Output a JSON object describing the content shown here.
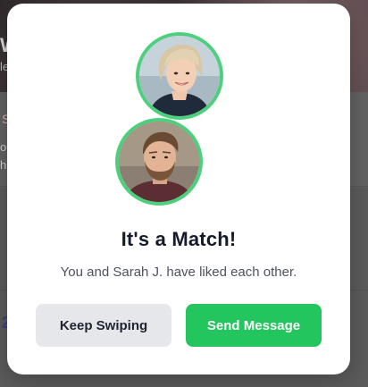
{
  "background": {
    "edge_chars": [
      "W",
      "le",
      "S",
      "o",
      "h",
      "2"
    ]
  },
  "modal": {
    "title": "It's a Match!",
    "subtitle": "You and Sarah J. have liked each other.",
    "match_avatar_icon": "sarah-avatar",
    "user_avatar_icon": "user-avatar",
    "ring_color": "#4cd07d"
  },
  "actions": {
    "keep_swiping_label": "Keep Swiping",
    "send_message_label": "Send Message",
    "primary_color": "#22c55e"
  }
}
